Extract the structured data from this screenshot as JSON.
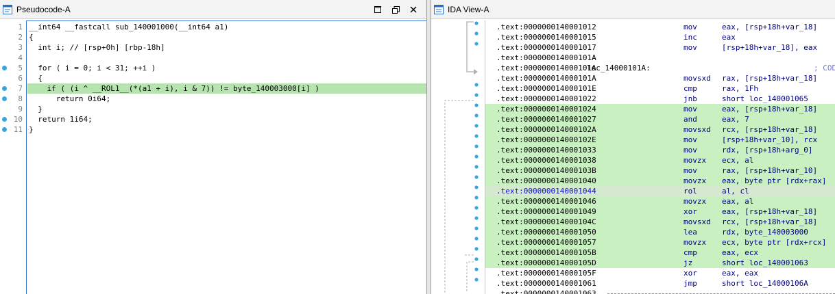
{
  "left_pane": {
    "title": "Pseudocode-A",
    "lines": [
      {
        "num": "1",
        "bp": false,
        "text": "__int64 __fastcall sub_140001000(__int64 a1)"
      },
      {
        "num": "2",
        "bp": false,
        "text": "{"
      },
      {
        "num": "3",
        "bp": false,
        "text": "  int i; // [rsp+0h] [rbp-18h]"
      },
      {
        "num": "4",
        "bp": false,
        "text": ""
      },
      {
        "num": "5",
        "bp": true,
        "text": "  for ( i = 0; i < 31; ++i )"
      },
      {
        "num": "6",
        "bp": false,
        "text": "  {"
      },
      {
        "num": "7",
        "bp": true,
        "text": "    if ( (i ^ __ROL1__(*(a1 + i), i & 7)) != byte_140003000[i] )"
      },
      {
        "num": "8",
        "bp": true,
        "text": "      return 0i64;"
      },
      {
        "num": "9",
        "bp": false,
        "text": "  }"
      },
      {
        "num": "10",
        "bp": true,
        "text": "  return 1i64;"
      },
      {
        "num": "11",
        "bp": true,
        "text": "}"
      }
    ]
  },
  "right_pane": {
    "title": "IDA View-A",
    "rows": [
      {
        "addr": ".text:0000000140001012",
        "label": "",
        "mn": "mov",
        "op": "eax, [rsp+18h+var_18]",
        "cmt": "",
        "hl": false
      },
      {
        "addr": ".text:0000000140001015",
        "label": "",
        "mn": "inc",
        "op": "eax",
        "cmt": "",
        "hl": false
      },
      {
        "addr": ".text:0000000140001017",
        "label": "",
        "mn": "mov",
        "op": "[rsp+18h+var_18], eax",
        "cmt": "",
        "hl": false
      },
      {
        "addr": ".text:000000014000101A",
        "label": "",
        "mn": "",
        "op": "",
        "cmt": "",
        "hl": false
      },
      {
        "addr": ".text:000000014000101A",
        "label": "loc_14000101A:",
        "mn": "",
        "op": "",
        "cmt": "; CODE X",
        "hl": false
      },
      {
        "addr": ".text:000000014000101A",
        "label": "",
        "mn": "movsxd",
        "op": "rax, [rsp+18h+var_18]",
        "cmt": "",
        "hl": false
      },
      {
        "addr": ".text:000000014000101E",
        "label": "",
        "mn": "cmp",
        "op": "rax, 1Fh",
        "cmt": "",
        "hl": false
      },
      {
        "addr": ".text:0000000140001022",
        "label": "",
        "mn": "jnb",
        "op": "short loc_140001065",
        "cmt": "",
        "hl": false
      },
      {
        "addr": ".text:0000000140001024",
        "label": "",
        "mn": "mov",
        "op": "eax, [rsp+18h+var_18]",
        "cmt": "",
        "hl": true
      },
      {
        "addr": ".text:0000000140001027",
        "label": "",
        "mn": "and",
        "op": "eax, 7",
        "cmt": "",
        "hl": true
      },
      {
        "addr": ".text:000000014000102A",
        "label": "",
        "mn": "movsxd",
        "op": "rcx, [rsp+18h+var_18]",
        "cmt": "",
        "hl": true
      },
      {
        "addr": ".text:000000014000102E",
        "label": "",
        "mn": "mov",
        "op": "[rsp+18h+var_10], rcx",
        "cmt": "",
        "hl": true
      },
      {
        "addr": ".text:0000000140001033",
        "label": "",
        "mn": "mov",
        "op": "rdx, [rsp+18h+arg_0]",
        "cmt": "",
        "hl": true
      },
      {
        "addr": ".text:0000000140001038",
        "label": "",
        "mn": "movzx",
        "op": "ecx, al",
        "cmt": "",
        "hl": true
      },
      {
        "addr": ".text:000000014000103B",
        "label": "",
        "mn": "mov",
        "op": "rax, [rsp+18h+var_10]",
        "cmt": "",
        "hl": true
      },
      {
        "addr": ".text:0000000140001040",
        "label": "",
        "mn": "movzx",
        "op": "eax, byte ptr [rdx+rax]",
        "cmt": "",
        "hl": true
      },
      {
        "addr": ".text:0000000140001044",
        "label": "",
        "mn": "rol",
        "op": "al, cl",
        "cmt": "",
        "hl": true
      },
      {
        "addr": ".text:0000000140001046",
        "label": "",
        "mn": "movzx",
        "op": "eax, al",
        "cmt": "",
        "hl": true
      },
      {
        "addr": ".text:0000000140001049",
        "label": "",
        "mn": "xor",
        "op": "eax, [rsp+18h+var_18]",
        "cmt": "",
        "hl": true
      },
      {
        "addr": ".text:000000014000104C",
        "label": "",
        "mn": "movsxd",
        "op": "rcx, [rsp+18h+var_18]",
        "cmt": "",
        "hl": true
      },
      {
        "addr": ".text:0000000140001050",
        "label": "",
        "mn": "lea",
        "op": "rdx, byte_140003000",
        "cmt": "",
        "hl": true
      },
      {
        "addr": ".text:0000000140001057",
        "label": "",
        "mn": "movzx",
        "op": "ecx, byte ptr [rdx+rcx]",
        "cmt": "",
        "hl": true
      },
      {
        "addr": ".text:000000014000105B",
        "label": "",
        "mn": "cmp",
        "op": "eax, ecx",
        "cmt": "",
        "hl": true
      },
      {
        "addr": ".text:000000014000105D",
        "label": "",
        "mn": "jz",
        "op": "short loc_140001063",
        "cmt": "",
        "hl": true
      },
      {
        "addr": ".text:000000014000105F",
        "label": "",
        "mn": "xor",
        "op": "eax, eax",
        "cmt": "",
        "hl": false
      },
      {
        "addr": ".text:0000000140001061",
        "label": "",
        "mn": "jmp",
        "op": "short loc_14000106A",
        "cmt": "",
        "hl": false
      },
      {
        "addr": ".text:0000000140001063",
        "label": "",
        "mn": "",
        "op": "",
        "cmt": "",
        "hl": false
      }
    ]
  },
  "colors": {
    "highlight_green": "#c8f0c0",
    "pseudocode_highlight": "#b7e3b0",
    "breakpoint_dot": "#38a6e0"
  }
}
